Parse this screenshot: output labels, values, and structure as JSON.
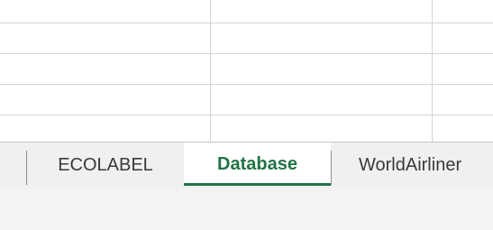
{
  "sheet_tabs": {
    "tabs": [
      {
        "label": "ECOLABEL",
        "active": false
      },
      {
        "label": "Database",
        "active": true
      },
      {
        "label": "WorldAirliner",
        "active": false
      }
    ]
  },
  "colors": {
    "accent": "#217346",
    "gridline": "#d4d4d4",
    "tab_bar_background": "#f0f0f0"
  }
}
